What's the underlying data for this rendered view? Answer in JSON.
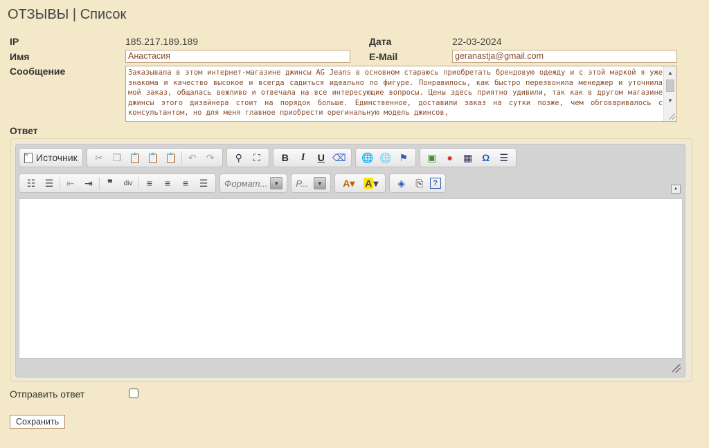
{
  "page": {
    "title": "ОТЗЫВЫ | Список"
  },
  "fields": {
    "ip_label": "IP",
    "ip_value": "185.217.189.189",
    "date_label": "Дата",
    "date_value": "22-03-2024",
    "name_label": "Имя",
    "name_value": "Анастасия",
    "email_label": "E-Mail",
    "email_value": "geranastja@gmail.com",
    "message_label": "Сообщение",
    "message_value": "Заказывала в этом интернет-магазине джинсы AG Jeans в основном стараюсь приобретать брендовую одежду и с этой маркой я уже знакома и качество высокое и всегда садиться идеально по фигуре. Понравилось, как быстро перезвонила менеджер и уточнила мой заказ, общалась вежливо и отвечала на все интересующие вопросы. Цены здесь приятно удивили, так как в другом магазине джинсы этого дизайнера стоит на порядок больше. Единственное, доставили заказ на сутки позже, чем обговаривалось с консультантом, но для меня главное приобрести орегинальную модель джинсов,",
    "answer_label": "Ответ"
  },
  "editor": {
    "source_label": "Источник",
    "format_placeholder": "Формат...",
    "font_placeholder": "Р...",
    "toolbar_row1_icons": [
      "cut-icon",
      "copy-icon",
      "paste-icon",
      "paste-text-icon",
      "paste-word-icon",
      "undo-icon",
      "redo-icon",
      "find-icon",
      "select-all-icon",
      "bold-icon",
      "italic-icon",
      "underline-icon",
      "remove-format-icon",
      "link-icon",
      "unlink-icon",
      "anchor-icon",
      "image-icon",
      "flash-icon",
      "table-icon",
      "special-char-icon",
      "page-break-icon"
    ],
    "toolbar_row2_icons": [
      "numbered-list-icon",
      "bulleted-list-icon",
      "outdent-icon",
      "indent-icon",
      "blockquote-icon",
      "create-div-icon",
      "align-left-icon",
      "align-center-icon",
      "align-right-icon",
      "justify-icon",
      "text-color-icon",
      "bg-color-icon",
      "maximize-icon",
      "show-blocks-icon",
      "about-icon"
    ]
  },
  "footer": {
    "send_reply_label": "Отправить ответ",
    "save_label": "Сохранить"
  },
  "colors": {
    "background": "#f3e9c9",
    "input_text": "#8a4b2a",
    "input_border": "#c3a37a"
  }
}
